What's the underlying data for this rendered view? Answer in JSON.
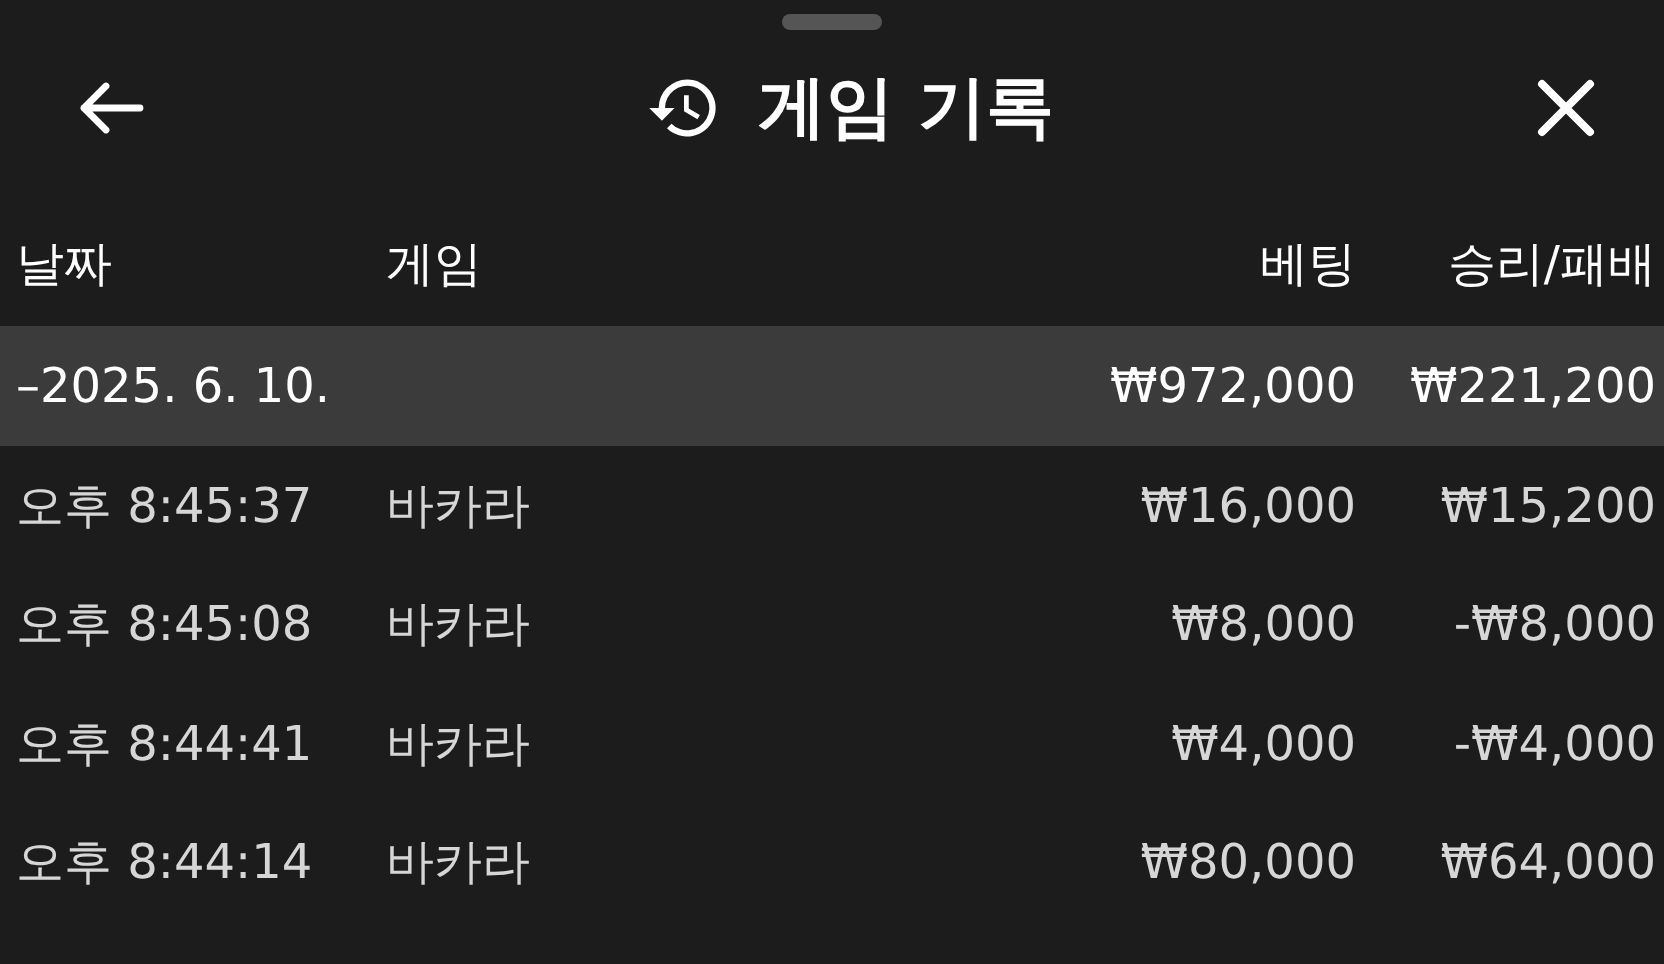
{
  "header": {
    "title": "게임 기록"
  },
  "table": {
    "columns": [
      "날짜",
      "게임",
      "베팅",
      "승리/패배"
    ],
    "group": {
      "date": "–2025. 6. 10.",
      "bet": "₩972,000",
      "result": "₩221,200"
    },
    "rows": [
      {
        "time": "오후 8:45:37",
        "game": "바카라",
        "bet": "₩16,000",
        "result": "₩15,200"
      },
      {
        "time": "오후 8:45:08",
        "game": "바카라",
        "bet": "₩8,000",
        "result": "-₩8,000"
      },
      {
        "time": "오후 8:44:41",
        "game": "바카라",
        "bet": "₩4,000",
        "result": "-₩4,000"
      },
      {
        "time": "오후 8:44:14",
        "game": "바카라",
        "bet": "₩80,000",
        "result": "₩64,000"
      }
    ]
  }
}
